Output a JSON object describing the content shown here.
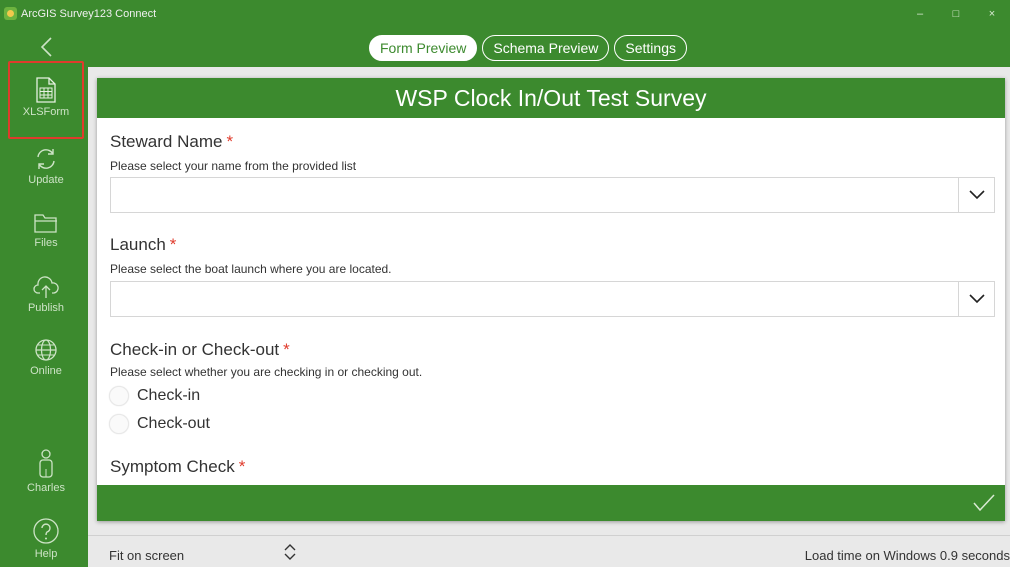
{
  "window": {
    "title": "ArcGIS Survey123 Connect",
    "controls": {
      "minimize": "–",
      "maximize": "□",
      "close": "×"
    }
  },
  "nav": {
    "back_icon": "chevron-left-icon",
    "tabs": [
      {
        "label": "Form Preview",
        "active": true
      },
      {
        "label": "Schema Preview",
        "active": false
      },
      {
        "label": "Settings",
        "active": false
      }
    ]
  },
  "sidebar": {
    "items": [
      {
        "label": "XLSForm",
        "icon": "spreadsheet-icon",
        "selected": true
      },
      {
        "label": "Update",
        "icon": "refresh-icon"
      },
      {
        "label": "Files",
        "icon": "folder-icon"
      },
      {
        "label": "Publish",
        "icon": "cloud-upload-icon"
      },
      {
        "label": "Online",
        "icon": "globe-icon"
      }
    ],
    "user": {
      "label": "Charles",
      "icon": "user-icon"
    },
    "help": {
      "label": "Help",
      "icon": "help-icon"
    }
  },
  "form": {
    "title": "WSP Clock In/Out Test Survey",
    "required_marker": "*",
    "questions": [
      {
        "label": "Steward Name",
        "hint": "Please select your name from the provided list",
        "type": "select",
        "value": ""
      },
      {
        "label": "Launch",
        "hint": "Please select the boat launch where you are located.",
        "type": "select",
        "value": ""
      },
      {
        "label": "Check-in or Check-out",
        "hint": "Please select whether you are checking in or checking out.",
        "type": "radio",
        "options": [
          "Check-in",
          "Check-out"
        ]
      },
      {
        "label": "Symptom Check",
        "hint": "",
        "type": "partial"
      }
    ],
    "submit_icon": "checkmark-icon"
  },
  "bottom": {
    "zoom_label": "Fit on screen",
    "load_time": "Load time on Windows 0.9 seconds"
  },
  "colors": {
    "brand_green": "#3c8a2e",
    "required_red": "#e03b2c",
    "highlight_border": "#e03b2c"
  }
}
